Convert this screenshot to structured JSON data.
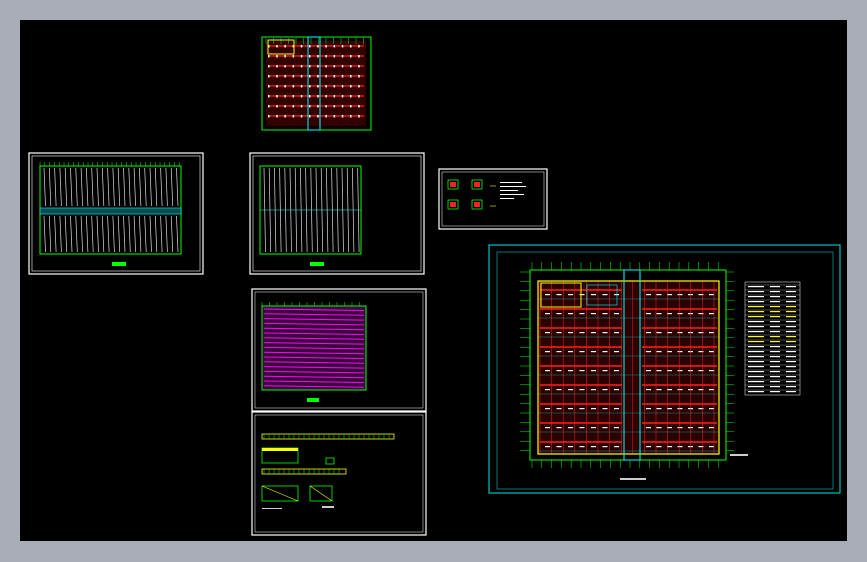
{
  "viewer": {
    "background_color": "#000000",
    "frame_color": "#a9adb6",
    "accent_colors": {
      "sheet_border": "#ffffff",
      "grid_green": "#00ff00",
      "column_yellow": "#ffff00",
      "beam_red": "#ff2020",
      "cyan_line": "#00ffff",
      "magenta_fill": "#ff00ff",
      "large_sheet_border": "#00c0c0"
    }
  },
  "sheets": [
    {
      "id": "top-plan",
      "kind": "floor-plan"
    },
    {
      "id": "roof-left",
      "kind": "roof-plan"
    },
    {
      "id": "roof-right",
      "kind": "roof-plan"
    },
    {
      "id": "details-small",
      "kind": "detail-sheet"
    },
    {
      "id": "magenta-plan",
      "kind": "hatched-plan"
    },
    {
      "id": "sections",
      "kind": "section-sheet"
    },
    {
      "id": "main-plan",
      "kind": "floor-plan-with-table"
    }
  ]
}
